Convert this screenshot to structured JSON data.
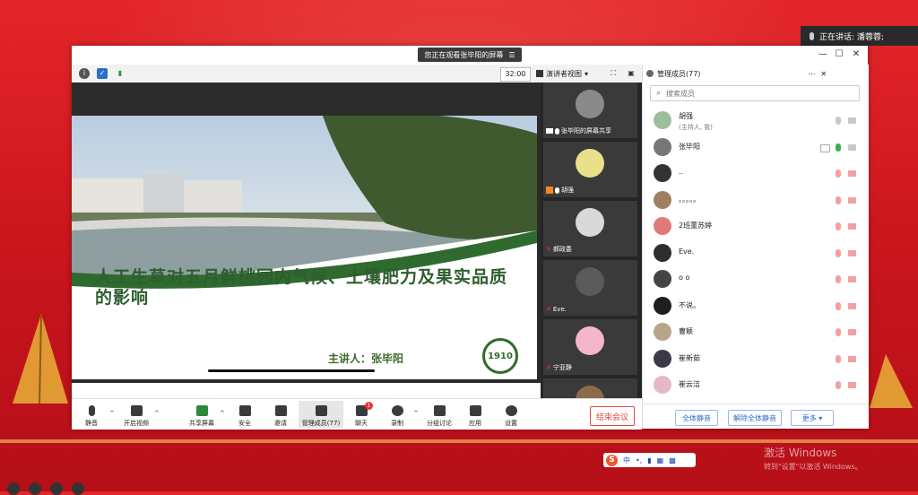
{
  "speaking_toast": {
    "text": "正在讲话: 潘蓉蓉;"
  },
  "window": {
    "viewing_label": "您正在观看张毕阳的屏幕",
    "timer": "32:00",
    "speaker_view_label": "演讲者视图"
  },
  "slide": {
    "title": "人工生草对五月鲜桃园内气候、土壤肥力及果实品质的影响",
    "presenter": "主讲人：张毕阳",
    "logo_text": "1910"
  },
  "thumbnails": [
    {
      "label": "张毕阳的屏幕共享",
      "color": "#8a8a8a"
    },
    {
      "label": "胡强",
      "color": "#e9e08a"
    },
    {
      "label": "郝政委",
      "color": "#d9d9d9"
    },
    {
      "label": "Eve.",
      "color": "#5a5a5a"
    },
    {
      "label": "宁亚静",
      "color": "#f4b6c8"
    },
    {
      "label": "",
      "color": "#8c6a4a"
    }
  ],
  "panel": {
    "title": "管理成员(77)",
    "search_placeholder": "搜索成员",
    "members": [
      {
        "name": "胡强",
        "sub": "(主持人, 我)",
        "color": "#9bbf9b",
        "mic": "gray",
        "cam": "gray"
      },
      {
        "name": "张毕阳",
        "sub": "",
        "color": "#777777",
        "mic": "green",
        "cam": "gray"
      },
      {
        "name": "..",
        "sub": "",
        "color": "#333333",
        "mic": "red",
        "cam": "red"
      },
      {
        "name": "。。。。。",
        "sub": "",
        "color": "#a08060",
        "mic": "red",
        "cam": "red"
      },
      {
        "name": "2班董苏婷",
        "sub": "",
        "color": "#e07a7a",
        "mic": "red",
        "cam": "red"
      },
      {
        "name": "Eve.",
        "sub": "",
        "color": "#2d2d2d",
        "mic": "red",
        "cam": "red"
      },
      {
        "name": "o o",
        "sub": "",
        "color": "#444444",
        "mic": "red",
        "cam": "red"
      },
      {
        "name": "不说。",
        "sub": "",
        "color": "#1f1f1f",
        "mic": "red",
        "cam": "red"
      },
      {
        "name": "曹颖",
        "sub": "",
        "color": "#b9a58a",
        "mic": "red",
        "cam": "red"
      },
      {
        "name": "崔新茹",
        "sub": "",
        "color": "#3a3a4a",
        "mic": "red",
        "cam": "red"
      },
      {
        "name": "崔云洁",
        "sub": "",
        "color": "#e6b8c6",
        "mic": "red",
        "cam": "red"
      }
    ],
    "footer": {
      "mute_all": "全体静音",
      "unmute_all": "解除全体静音",
      "more": "更多 ▾"
    }
  },
  "toolbar": {
    "mute": "静音",
    "video": "开启视频",
    "share": "共享屏幕",
    "security": "安全",
    "invite": "邀请",
    "members": "管理成员(77)",
    "chat": "聊天",
    "chat_badge": "1",
    "record": "录制",
    "breakout": "分组讨论",
    "apps": "应用",
    "settings": "设置",
    "end": "结束会议"
  },
  "ime": {
    "logo": "S",
    "lang": "中",
    "punct": "•,"
  },
  "watermark": {
    "line1": "激活 Windows",
    "line2": "转到\"设置\"以激活 Windows。"
  },
  "colors": {
    "accent_blue": "#2c6ecb",
    "end_red": "#e04b3a",
    "slide_green": "#2e5e2e",
    "bg_red": "#d11a22"
  }
}
